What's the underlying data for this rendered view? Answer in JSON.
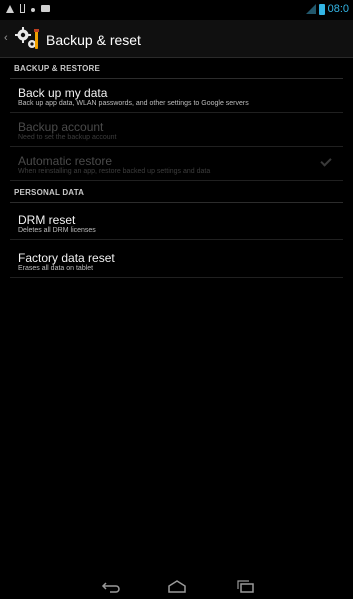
{
  "status_bar": {
    "time": "08:0",
    "icons": [
      "warning-icon",
      "usb-icon",
      "dot-icon",
      "image-icon",
      "signal-icon",
      "battery-icon"
    ],
    "accent": "#33b5e5"
  },
  "action_bar": {
    "title": "Backup & reset",
    "icon": "settings-gear-icon"
  },
  "sections": {
    "backup_restore": "BACKUP & RESTORE",
    "personal_data": "PERSONAL DATA"
  },
  "items": {
    "backup_my_data": {
      "title": "Back up my data",
      "summary": "Back up app data, WLAN passwords, and other settings to Google servers"
    },
    "backup_account": {
      "title": "Backup account",
      "summary": "Need to set the backup account"
    },
    "automatic_restore": {
      "title": "Automatic restore",
      "summary": "When reinstalling an app, restore backed up settings and data",
      "checked": true
    },
    "drm_reset": {
      "title": "DRM reset",
      "summary": "Deletes all DRM licenses"
    },
    "factory_reset": {
      "title": "Factory data reset",
      "summary": "Erases all data on tablet"
    }
  },
  "nav_bar": {
    "icons": [
      "back-icon",
      "home-icon",
      "recent-apps-icon"
    ]
  }
}
